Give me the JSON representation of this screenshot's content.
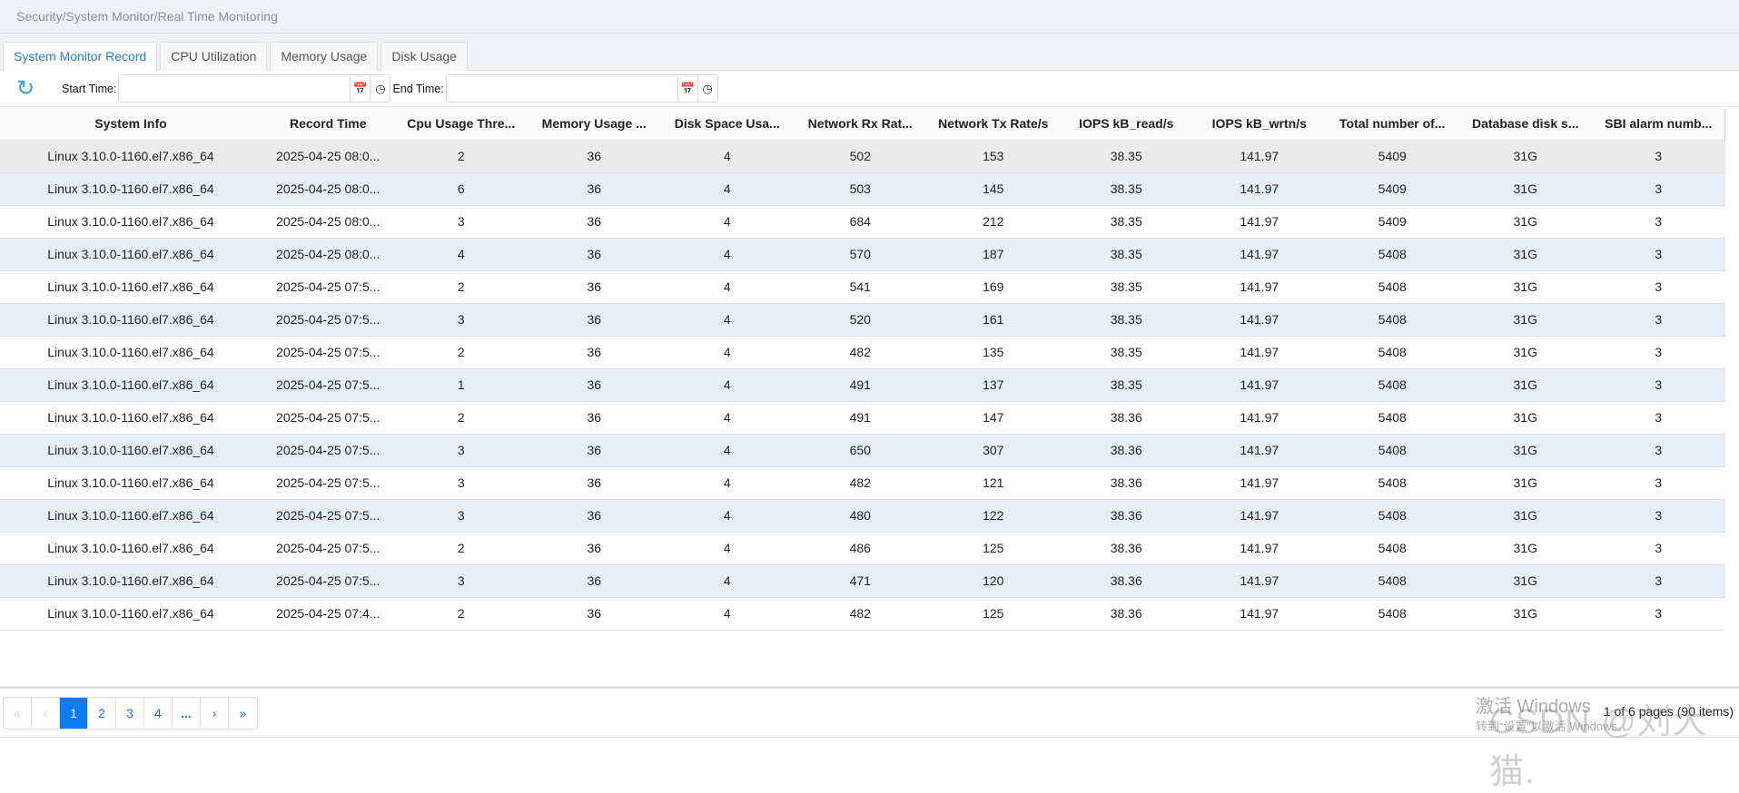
{
  "breadcrumb": "Security/System Monitor/Real Time Monitoring",
  "tabs": [
    {
      "label": "System Monitor Record",
      "active": true
    },
    {
      "label": "CPU Utilization"
    },
    {
      "label": "Memory Usage"
    },
    {
      "label": "Disk Usage"
    }
  ],
  "toolbar": {
    "start_label": "Start Time:",
    "start_value": "",
    "end_label": "End Time:",
    "end_value": "",
    "icons": [
      "refresh-icon",
      "calendar-icon",
      "clock-icon"
    ]
  },
  "table": {
    "columns": [
      "System Info",
      "Record Time",
      "Cpu Usage Thre...",
      "Memory Usage ...",
      "Disk Space Usa...",
      "Network Rx Rat...",
      "Network Tx Rate/s",
      "IOPS kB_read/s",
      "IOPS kB_wrtn/s",
      "Total number of...",
      "Database disk s...",
      "SBI alarm numb..."
    ],
    "rows": [
      [
        "Linux 3.10.0-1160.el7.x86_64",
        "2025-04-25 08:0...",
        "2",
        "36",
        "4",
        "502",
        "153",
        "38.35",
        "141.97",
        "5409",
        "31G",
        "3"
      ],
      [
        "Linux 3.10.0-1160.el7.x86_64",
        "2025-04-25 08:0...",
        "6",
        "36",
        "4",
        "503",
        "145",
        "38.35",
        "141.97",
        "5409",
        "31G",
        "3"
      ],
      [
        "Linux 3.10.0-1160.el7.x86_64",
        "2025-04-25 08:0...",
        "3",
        "36",
        "4",
        "684",
        "212",
        "38.35",
        "141.97",
        "5409",
        "31G",
        "3"
      ],
      [
        "Linux 3.10.0-1160.el7.x86_64",
        "2025-04-25 08:0...",
        "4",
        "36",
        "4",
        "570",
        "187",
        "38.35",
        "141.97",
        "5408",
        "31G",
        "3"
      ],
      [
        "Linux 3.10.0-1160.el7.x86_64",
        "2025-04-25 07:5...",
        "2",
        "36",
        "4",
        "541",
        "169",
        "38.35",
        "141.97",
        "5408",
        "31G",
        "3"
      ],
      [
        "Linux 3.10.0-1160.el7.x86_64",
        "2025-04-25 07:5...",
        "3",
        "36",
        "4",
        "520",
        "161",
        "38.35",
        "141.97",
        "5408",
        "31G",
        "3"
      ],
      [
        "Linux 3.10.0-1160.el7.x86_64",
        "2025-04-25 07:5...",
        "2",
        "36",
        "4",
        "482",
        "135",
        "38.35",
        "141.97",
        "5408",
        "31G",
        "3"
      ],
      [
        "Linux 3.10.0-1160.el7.x86_64",
        "2025-04-25 07:5...",
        "1",
        "36",
        "4",
        "491",
        "137",
        "38.35",
        "141.97",
        "5408",
        "31G",
        "3"
      ],
      [
        "Linux 3.10.0-1160.el7.x86_64",
        "2025-04-25 07:5...",
        "2",
        "36",
        "4",
        "491",
        "147",
        "38.36",
        "141.97",
        "5408",
        "31G",
        "3"
      ],
      [
        "Linux 3.10.0-1160.el7.x86_64",
        "2025-04-25 07:5...",
        "3",
        "36",
        "4",
        "650",
        "307",
        "38.36",
        "141.97",
        "5408",
        "31G",
        "3"
      ],
      [
        "Linux 3.10.0-1160.el7.x86_64",
        "2025-04-25 07:5...",
        "3",
        "36",
        "4",
        "482",
        "121",
        "38.36",
        "141.97",
        "5408",
        "31G",
        "3"
      ],
      [
        "Linux 3.10.0-1160.el7.x86_64",
        "2025-04-25 07:5...",
        "3",
        "36",
        "4",
        "480",
        "122",
        "38.36",
        "141.97",
        "5408",
        "31G",
        "3"
      ],
      [
        "Linux 3.10.0-1160.el7.x86_64",
        "2025-04-25 07:5...",
        "2",
        "36",
        "4",
        "486",
        "125",
        "38.36",
        "141.97",
        "5408",
        "31G",
        "3"
      ],
      [
        "Linux 3.10.0-1160.el7.x86_64",
        "2025-04-25 07:5...",
        "3",
        "36",
        "4",
        "471",
        "120",
        "38.36",
        "141.97",
        "5408",
        "31G",
        "3"
      ],
      [
        "Linux 3.10.0-1160.el7.x86_64",
        "2025-04-25 07:4...",
        "2",
        "36",
        "4",
        "482",
        "125",
        "38.36",
        "141.97",
        "5408",
        "31G",
        "3"
      ]
    ]
  },
  "pagination": {
    "first": "«",
    "prev": "‹",
    "pages": [
      "1",
      "2",
      "3",
      "4"
    ],
    "current": "1",
    "more": "...",
    "next": "›",
    "last": "»",
    "info": "1 of 6 pages (90 items)"
  },
  "watermark": {
    "line1": "激活 Windows",
    "line2": "转到“设置”以激活 Windows。",
    "csdn": "CSDN @刘大猫."
  },
  "colors": {
    "accent": "#0a7bf2",
    "alt_row": "#e8eef6",
    "selected_row": "#ebebeb"
  }
}
